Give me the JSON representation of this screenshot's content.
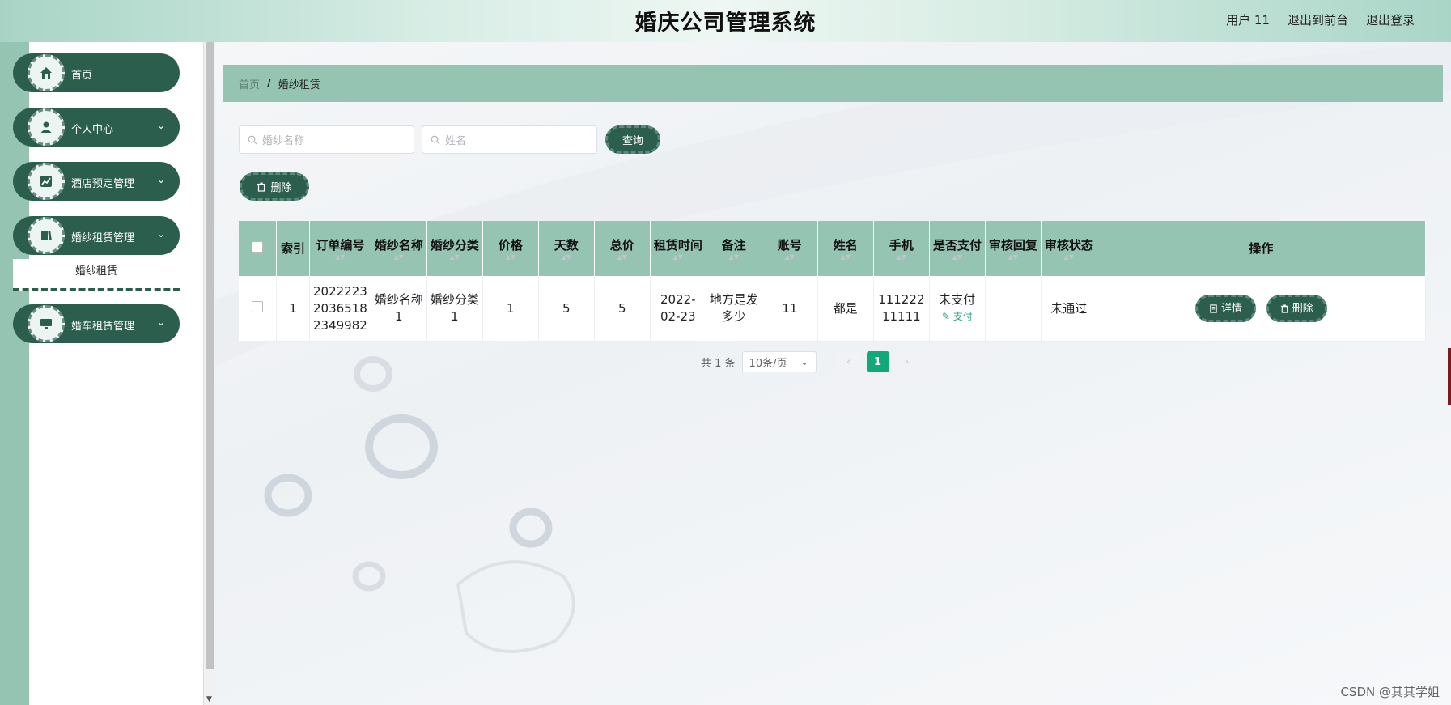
{
  "header": {
    "title": "婚庆公司管理系统",
    "user": "用户 11",
    "to_front": "退出到前台",
    "logout": "退出登录"
  },
  "sidebar": {
    "items": [
      {
        "label": "首页",
        "icon": "home-icon"
      },
      {
        "label": "个人中心",
        "icon": "user-icon"
      },
      {
        "label": "酒店预定管理",
        "icon": "chart-icon"
      },
      {
        "label": "婚纱租赁管理",
        "icon": "book-icon"
      },
      {
        "label": "婚车租赁管理",
        "icon": "monitor-icon"
      }
    ],
    "submenu": "婚纱租赁"
  },
  "breadcrumb": {
    "home": "首页",
    "separator": "/",
    "current": "婚纱租赁"
  },
  "search": {
    "name_placeholder": "婚纱名称",
    "user_placeholder": "姓名",
    "query_button": "查询",
    "delete_button": "删除"
  },
  "table": {
    "columns": [
      "索引",
      "订单编号",
      "婚纱名称",
      "婚纱分类",
      "价格",
      "天数",
      "总价",
      "租赁时间",
      "备注",
      "账号",
      "姓名",
      "手机",
      "是否支付",
      "审核回复",
      "审核状态",
      "操作"
    ],
    "rows": [
      {
        "index": "1",
        "order_no": "2022223 2036518 2349982",
        "name": "婚纱名称1",
        "category": "婚纱分类1",
        "price": "1",
        "days": "5",
        "total": "5",
        "rent_time": "2022-02-23",
        "remark": "地方是发多少",
        "account": "11",
        "real_name": "都是",
        "phone": "11122211111",
        "paid": "未支付",
        "pay_link": "支付",
        "reply": "",
        "status": "未通过",
        "detail_btn": "详情",
        "delete_btn": "删除"
      }
    ]
  },
  "pagination": {
    "total": "共 1 条",
    "page_size": "10条/页",
    "current": "1"
  },
  "watermark": "CSDN @其其学姐",
  "colors": {
    "primary": "#2c5e4e",
    "accent": "#95c4b3",
    "active_page": "#12a97a"
  }
}
